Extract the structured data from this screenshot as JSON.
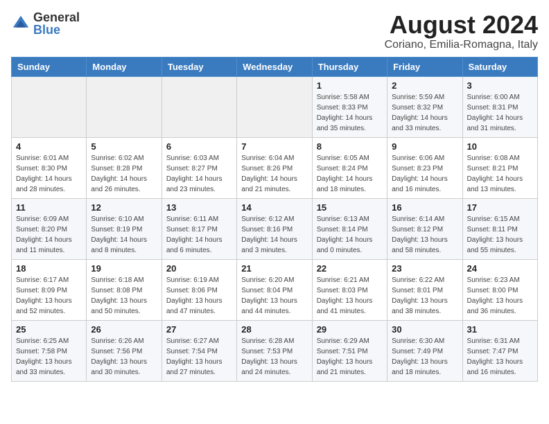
{
  "logo": {
    "general": "General",
    "blue": "Blue"
  },
  "title": {
    "month_year": "August 2024",
    "location": "Coriano, Emilia-Romagna, Italy"
  },
  "headers": [
    "Sunday",
    "Monday",
    "Tuesday",
    "Wednesday",
    "Thursday",
    "Friday",
    "Saturday"
  ],
  "weeks": [
    [
      {
        "day": "",
        "info": ""
      },
      {
        "day": "",
        "info": ""
      },
      {
        "day": "",
        "info": ""
      },
      {
        "day": "",
        "info": ""
      },
      {
        "day": "1",
        "info": "Sunrise: 5:58 AM\nSunset: 8:33 PM\nDaylight: 14 hours\nand 35 minutes."
      },
      {
        "day": "2",
        "info": "Sunrise: 5:59 AM\nSunset: 8:32 PM\nDaylight: 14 hours\nand 33 minutes."
      },
      {
        "day": "3",
        "info": "Sunrise: 6:00 AM\nSunset: 8:31 PM\nDaylight: 14 hours\nand 31 minutes."
      }
    ],
    [
      {
        "day": "4",
        "info": "Sunrise: 6:01 AM\nSunset: 8:30 PM\nDaylight: 14 hours\nand 28 minutes."
      },
      {
        "day": "5",
        "info": "Sunrise: 6:02 AM\nSunset: 8:28 PM\nDaylight: 14 hours\nand 26 minutes."
      },
      {
        "day": "6",
        "info": "Sunrise: 6:03 AM\nSunset: 8:27 PM\nDaylight: 14 hours\nand 23 minutes."
      },
      {
        "day": "7",
        "info": "Sunrise: 6:04 AM\nSunset: 8:26 PM\nDaylight: 14 hours\nand 21 minutes."
      },
      {
        "day": "8",
        "info": "Sunrise: 6:05 AM\nSunset: 8:24 PM\nDaylight: 14 hours\nand 18 minutes."
      },
      {
        "day": "9",
        "info": "Sunrise: 6:06 AM\nSunset: 8:23 PM\nDaylight: 14 hours\nand 16 minutes."
      },
      {
        "day": "10",
        "info": "Sunrise: 6:08 AM\nSunset: 8:21 PM\nDaylight: 14 hours\nand 13 minutes."
      }
    ],
    [
      {
        "day": "11",
        "info": "Sunrise: 6:09 AM\nSunset: 8:20 PM\nDaylight: 14 hours\nand 11 minutes."
      },
      {
        "day": "12",
        "info": "Sunrise: 6:10 AM\nSunset: 8:19 PM\nDaylight: 14 hours\nand 8 minutes."
      },
      {
        "day": "13",
        "info": "Sunrise: 6:11 AM\nSunset: 8:17 PM\nDaylight: 14 hours\nand 6 minutes."
      },
      {
        "day": "14",
        "info": "Sunrise: 6:12 AM\nSunset: 8:16 PM\nDaylight: 14 hours\nand 3 minutes."
      },
      {
        "day": "15",
        "info": "Sunrise: 6:13 AM\nSunset: 8:14 PM\nDaylight: 14 hours\nand 0 minutes."
      },
      {
        "day": "16",
        "info": "Sunrise: 6:14 AM\nSunset: 8:12 PM\nDaylight: 13 hours\nand 58 minutes."
      },
      {
        "day": "17",
        "info": "Sunrise: 6:15 AM\nSunset: 8:11 PM\nDaylight: 13 hours\nand 55 minutes."
      }
    ],
    [
      {
        "day": "18",
        "info": "Sunrise: 6:17 AM\nSunset: 8:09 PM\nDaylight: 13 hours\nand 52 minutes."
      },
      {
        "day": "19",
        "info": "Sunrise: 6:18 AM\nSunset: 8:08 PM\nDaylight: 13 hours\nand 50 minutes."
      },
      {
        "day": "20",
        "info": "Sunrise: 6:19 AM\nSunset: 8:06 PM\nDaylight: 13 hours\nand 47 minutes."
      },
      {
        "day": "21",
        "info": "Sunrise: 6:20 AM\nSunset: 8:04 PM\nDaylight: 13 hours\nand 44 minutes."
      },
      {
        "day": "22",
        "info": "Sunrise: 6:21 AM\nSunset: 8:03 PM\nDaylight: 13 hours\nand 41 minutes."
      },
      {
        "day": "23",
        "info": "Sunrise: 6:22 AM\nSunset: 8:01 PM\nDaylight: 13 hours\nand 38 minutes."
      },
      {
        "day": "24",
        "info": "Sunrise: 6:23 AM\nSunset: 8:00 PM\nDaylight: 13 hours\nand 36 minutes."
      }
    ],
    [
      {
        "day": "25",
        "info": "Sunrise: 6:25 AM\nSunset: 7:58 PM\nDaylight: 13 hours\nand 33 minutes."
      },
      {
        "day": "26",
        "info": "Sunrise: 6:26 AM\nSunset: 7:56 PM\nDaylight: 13 hours\nand 30 minutes."
      },
      {
        "day": "27",
        "info": "Sunrise: 6:27 AM\nSunset: 7:54 PM\nDaylight: 13 hours\nand 27 minutes."
      },
      {
        "day": "28",
        "info": "Sunrise: 6:28 AM\nSunset: 7:53 PM\nDaylight: 13 hours\nand 24 minutes."
      },
      {
        "day": "29",
        "info": "Sunrise: 6:29 AM\nSunset: 7:51 PM\nDaylight: 13 hours\nand 21 minutes."
      },
      {
        "day": "30",
        "info": "Sunrise: 6:30 AM\nSunset: 7:49 PM\nDaylight: 13 hours\nand 18 minutes."
      },
      {
        "day": "31",
        "info": "Sunrise: 6:31 AM\nSunset: 7:47 PM\nDaylight: 13 hours\nand 16 minutes."
      }
    ]
  ]
}
